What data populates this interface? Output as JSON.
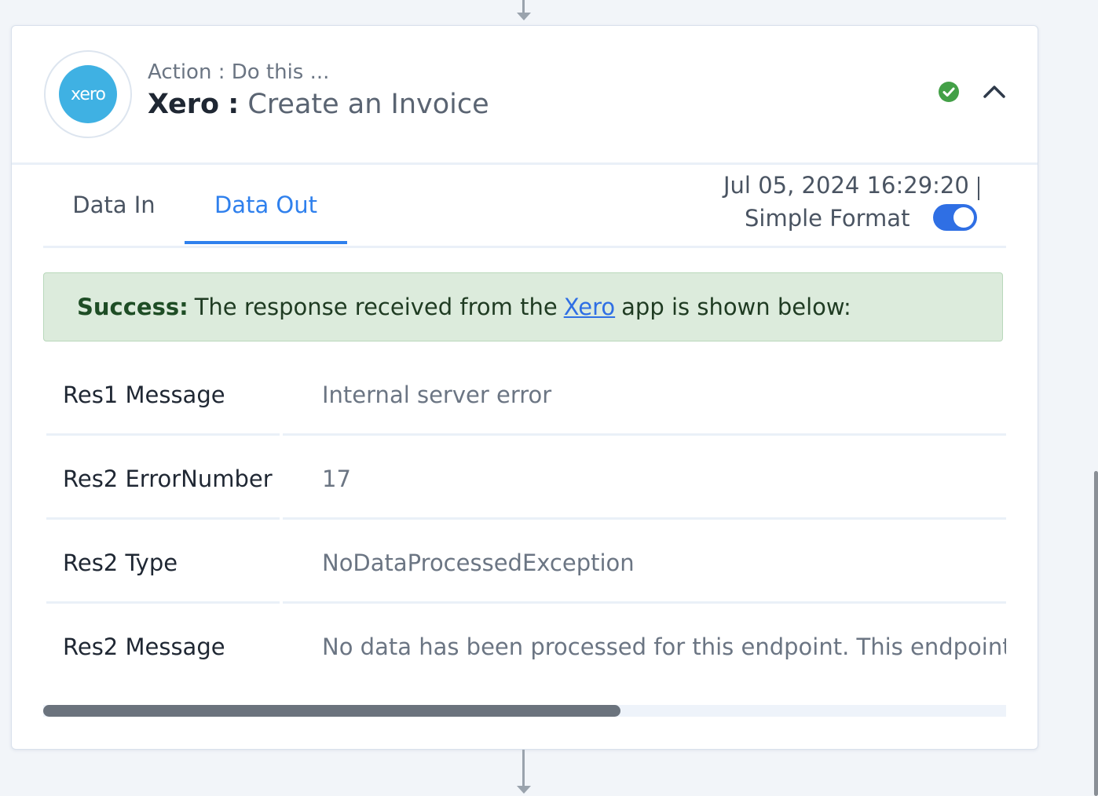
{
  "step": {
    "logo_text": "xero",
    "action_label": "Action : Do this ...",
    "app_name": "Xero",
    "separator": ":",
    "event_name": "Create an Invoice"
  },
  "tabs": [
    {
      "label": "Data In",
      "active": false
    },
    {
      "label": "Data Out",
      "active": true
    }
  ],
  "meta": {
    "timestamp": "Jul 05, 2024 16:29:20",
    "format_label": "Simple Format",
    "format_enabled": true
  },
  "alert": {
    "strong": "Success:",
    "text_before": "The response received from the",
    "link": "Xero",
    "text_after": "app is shown below:"
  },
  "rows": [
    {
      "key": "Res1 Message",
      "value": "Internal server error"
    },
    {
      "key": "Res2 ErrorNumber",
      "value": "17"
    },
    {
      "key": "Res2 Type",
      "value": "NoDataProcessedException"
    },
    {
      "key": "Res2 Message",
      "value": "No data has been processed for this endpoint. This endpoint is e"
    }
  ],
  "colors": {
    "accent": "#2f80ed",
    "success_bg": "#dcebdc",
    "status_ok": "#43a047",
    "xero_brand": "#3fb1e3"
  },
  "icons": {
    "status": "check-circle-icon",
    "collapse": "chevron-up-icon"
  }
}
